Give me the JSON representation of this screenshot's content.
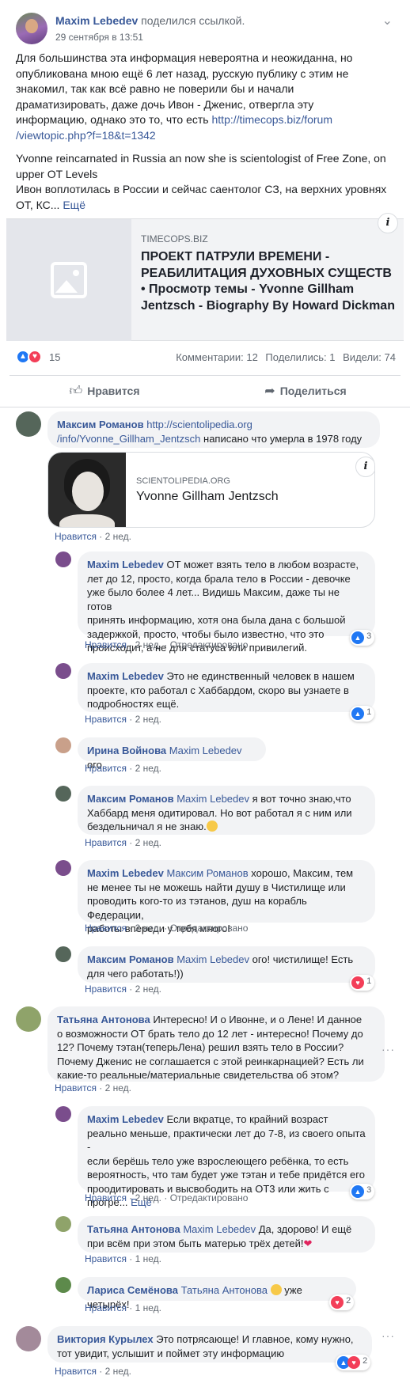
{
  "post": {
    "author": "Maxim Lebedev",
    "shared_text": "поделился ссылкой.",
    "timestamp": "29 сентября в 13:51",
    "text_lines": [
      "Для большинства эта информация невероятна и неожиданна, но",
      "опубликована мною ещё 6 лет назад, русскую публику с этим не",
      "знакомил, так как всё равно не поверили бы и начали",
      "драматизировать, даже дочь Ивон - Дженис, отвергла эту",
      "информацию, однако это то, что есть"
    ],
    "link_part1": "http://timecops.biz/forum",
    "link_part2": "/viewtopic.php?f=18&t=1342",
    "en_line1": "Yvonne reincarnated in Russia an now she is scientologist of Free Zone, on",
    "en_line2": "upper OT Levels",
    "ru_line1": "Ивон воплотилась в России и сейчас саентолог СЗ, на верхних уровнях",
    "ru_line2": "ОТ, КС...",
    "more": "Ещё"
  },
  "link_preview": {
    "domain": "TIMECOPS.BIZ",
    "title": "ПРОЕКТ ПАТРУЛИ ВРЕМЕНИ - РЕАБИЛИТАЦИЯ ДУХОВНЫХ СУЩЕСТВ • Просмотр темы - Yvonne Gillham Jentzsch - Biography By Howard Dickman"
  },
  "stats": {
    "reactions": "15",
    "comments": "Комментарии: 12",
    "shares": "Поделились: 1",
    "views": "Видели: 74"
  },
  "actions": {
    "like": "Нравится",
    "share": "Поделиться"
  },
  "colors": {
    "link": "#385898",
    "like": "#2078f4",
    "love": "#f33e58",
    "bubble": "#f2f3f5"
  },
  "comments": {
    "c1": {
      "author": "Максим Романов",
      "link1": "http://scientolipedia.org",
      "link2": "/info/Yvonne_Gillham_Jentzsch",
      "text": "написано что умерла в 1978 году",
      "preview_domain": "SCIENTOLIPEDIA.ORG",
      "preview_title": "Yvonne Gillham Jentzsch",
      "like": "Нравится",
      "time": "2 нед."
    },
    "r1": {
      "author": "Maxim Lebedev",
      "lines": [
        "ОТ может взять тело в любом возрасте,",
        "лет до 12, просто, когда брала тело в России - девочке",
        "уже было более 4 лет... Видишь Максим, даже ты не готов",
        "принять информацию, хотя она была дана с большой",
        "задержкой, просто, чтобы было известно, что это",
        "происходит, а не для статуса или привилегий."
      ],
      "like": "Нравится",
      "time": "2 нед.",
      "edited": "Отредактировано",
      "reactions": "3"
    },
    "r2": {
      "author": "Maxim Lebedev",
      "lines": [
        "Это не единственный человек в нашем",
        "проекте, кто работал с Хаббардом, скоро вы узнаете в",
        "подробностях ещё."
      ],
      "like": "Нравится",
      "time": "2 нед.",
      "reactions": "1"
    },
    "r3": {
      "author": "Ирина Войнова",
      "tag": "Maxim Lebedev",
      "text": "ого",
      "like": "Нравится",
      "time": "2 нед."
    },
    "r4": {
      "author": "Максим Романов",
      "tag": "Maxim Lebedev",
      "lines": [
        "я вот точно знаю,что",
        "Хаббард меня одитировал. Но вот работал я с ним или",
        "бездельничал я не знаю."
      ],
      "like": "Нравится",
      "time": "2 нед."
    },
    "r5": {
      "author": "Maxim Lebedev",
      "tag": "Максим Романов",
      "lines": [
        "хорошо, Максим, тем",
        "не менее ты не можешь найти душу в Чистилище или",
        "проводить кого-то из тэтанов, душ на корабль Федерации,",
        "работы впереди у тебя много!"
      ],
      "like": "Нравится",
      "time": "2 нед.",
      "edited": "Отредактировано"
    },
    "r6": {
      "author": "Максим Романов",
      "tag": "Maxim Lebedev",
      "lines": [
        "ого! чистилище! Есть",
        "для чего работать!))"
      ],
      "like": "Нравится",
      "time": "2 нед.",
      "reactions": "1"
    },
    "c2": {
      "author": "Татьяна Антонова",
      "lines": [
        "Интересно! И о Ивонне, и о Лене! И данное",
        "о возможности ОТ брать тело до 12 лет - интересно! Почему до",
        "12? Почему тэтан(теперьЛена) решил взять тело в России?",
        "Почему Дженис не соглашается с этой реинкарнацией? Есть ли",
        "какие-то реальные/материальные свидетельства об этом?"
      ],
      "like": "Нравится",
      "time": "2 нед."
    },
    "r7": {
      "author": "Maxim Lebedev",
      "lines": [
        "Если вкратце, то крайний возраст",
        "реально меньше, практически лет до 7-8, из своего опыта -",
        "если берёшь тело уже взрослеющего ребёнка, то есть",
        "вероятность, что там будет уже тэтан и тебе придётся его",
        "проодитировать и высвободить на ОТ3 или жить с",
        "прогре..."
      ],
      "more": "Ещё",
      "like": "Нравится",
      "time": "2 нед.",
      "edited": "Отредактировано",
      "reactions": "3"
    },
    "r8": {
      "author": "Татьяна Антонова",
      "tag": "Maxim Lebedev",
      "lines": [
        "Да, здорово! И ещё",
        "при всём при этом быть матерью трёх детей!"
      ],
      "like": "Нравится",
      "time": "1 нед."
    },
    "r9": {
      "author": "Лариса Семёнова",
      "tag": "Татьяна Антонова",
      "text": "уже четырёх!",
      "like": "Нравится",
      "time": "1 нед.",
      "reactions": "2"
    },
    "c3": {
      "author": "Виктория Курылех",
      "lines": [
        "Это потрясающе! И главное, кому нужно,",
        "тот увидит, услышит и поймет эту информацию"
      ],
      "like": "Нравится",
      "time": "2 нед.",
      "reactions": "2"
    }
  }
}
